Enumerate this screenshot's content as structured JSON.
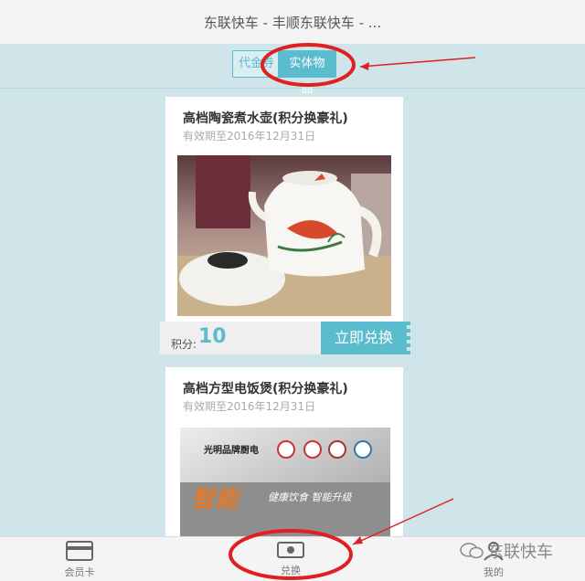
{
  "window": {
    "title": "东联快车 - 丰顺东联快车 - ..."
  },
  "tabs": [
    {
      "label": "代金券"
    },
    {
      "label": "实体物品"
    }
  ],
  "products": [
    {
      "title": "高档陶瓷煮水壶(积分换豪礼)",
      "valid_until": "有效期至2016年12月31日",
      "points_label": "积分:",
      "points_value": "10",
      "button_label": "立即兑换"
    },
    {
      "title": "高档方型电饭煲(积分换豪礼)",
      "valid_until": "有效期至2016年12月31日",
      "brand_text": "光明品牌厨电",
      "promo_big": "智能",
      "promo_sub": "健康饮食  智能升级"
    }
  ],
  "bottom_nav": [
    {
      "label": "会员卡",
      "icon": "card-icon"
    },
    {
      "label": "兑换",
      "icon": "cash-icon"
    },
    {
      "label": "我的",
      "icon": "user-icon"
    }
  ],
  "watermark": {
    "text": "东联快车"
  },
  "colors": {
    "accent": "#5bbccd",
    "background": "#cfe5ea",
    "annotation": "#e02020"
  }
}
